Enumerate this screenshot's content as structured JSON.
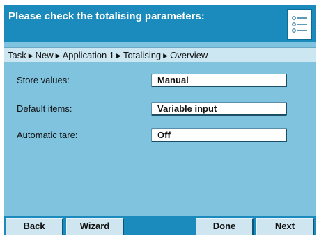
{
  "header": {
    "title": "Please check the totalising parameters:",
    "list_icon": "list-icon"
  },
  "breadcrumb": {
    "items": [
      "Task",
      "New",
      "Application 1",
      "Totalising",
      "Overview"
    ],
    "separator": "▶"
  },
  "rows": [
    {
      "label": "Store values:",
      "value": "Manual"
    },
    {
      "label": "Default items:",
      "value": "Variable input"
    },
    {
      "label": "Automatic tare:",
      "value": "Off"
    }
  ],
  "footer": {
    "back": "Back",
    "wizard": "Wizard",
    "done": "Done",
    "next": "Next"
  },
  "colors": {
    "header": "#1a8bbc",
    "panel": "#7fc3de",
    "breadcrumb": "#cce6f2",
    "button": "#cfe6f1"
  }
}
